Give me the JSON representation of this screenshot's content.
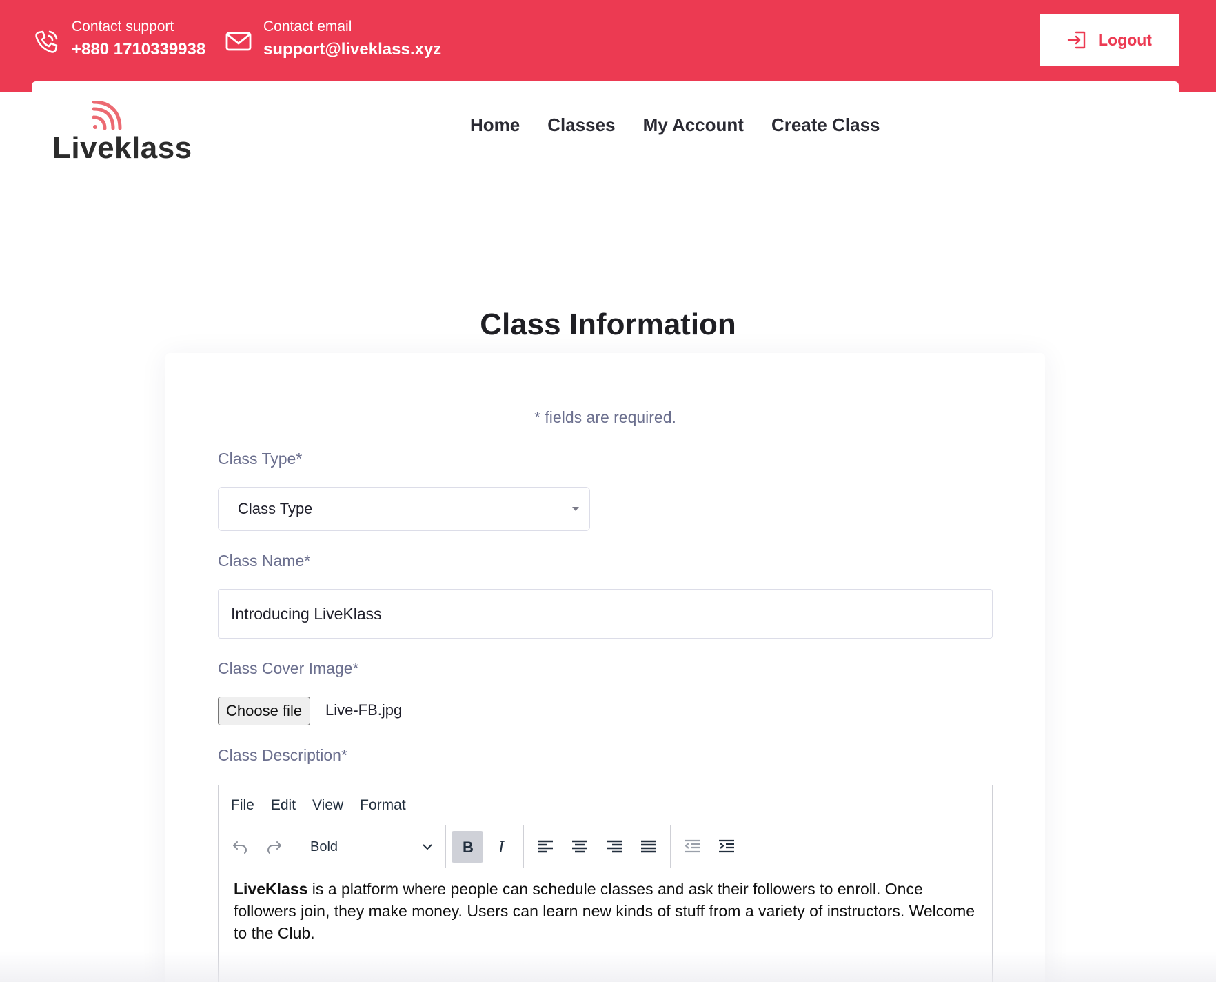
{
  "topbar": {
    "support": {
      "label": "Contact support",
      "value": "+880 1710339938",
      "icon": "phone-icon"
    },
    "email": {
      "label": "Contact email",
      "value": "support@liveklass.xyz",
      "icon": "mail-icon"
    },
    "logout_label": "Logout",
    "color": "#ec3a52"
  },
  "brand": {
    "name": "Liveklass",
    "accent": "#ec3a52"
  },
  "nav": [
    {
      "label": "Home"
    },
    {
      "label": "Classes"
    },
    {
      "label": "My Account"
    },
    {
      "label": "Create Class"
    }
  ],
  "page": {
    "title": "Class Information"
  },
  "form": {
    "required_note": "* fields are required.",
    "class_type": {
      "label": "Class Type*",
      "selected": "Class Type"
    },
    "class_name": {
      "label": "Class Name*",
      "value": "Introducing LiveKlass"
    },
    "cover_image": {
      "label": "Class Cover Image*",
      "button": "Choose file",
      "filename": "Live-FB.jpg"
    },
    "description": {
      "label": "Class Description*",
      "menu": [
        "File",
        "Edit",
        "View",
        "Format"
      ],
      "block_format": "Bold",
      "content_bold": "LiveKlass",
      "content_rest": " is a platform where people can schedule classes and ask their followers to enroll. Once followers join, they make money. Users can learn new kinds of stuff from a variety of instructors. Welcome to the Club."
    }
  }
}
